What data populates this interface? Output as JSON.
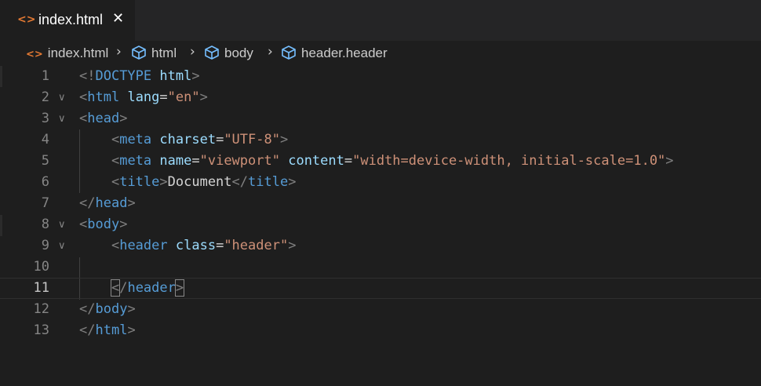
{
  "tab": {
    "icon": "<>",
    "label": "index.html",
    "close": "✕"
  },
  "breadcrumb": [
    {
      "label": "index.html",
      "icon": "html-file-icon"
    },
    {
      "label": "html",
      "icon": "cube-icon"
    },
    {
      "label": "body",
      "icon": "cube-icon"
    },
    {
      "label": "header.header",
      "icon": "cube-icon"
    }
  ],
  "breadcrumb_separator": "›",
  "fold_glyph": "∨",
  "colors": {
    "tag": "#569cd6",
    "attr": "#9cdcfe",
    "string": "#ce9178",
    "punct": "#808080",
    "text": "#d4d4d4",
    "line_number": "#858585",
    "file_icon": "#e37933"
  },
  "lines": [
    {
      "n": "1",
      "tokens": [
        [
          "p",
          "<!"
        ],
        [
          "t",
          "DOCTYPE"
        ],
        [
          "x",
          " "
        ],
        [
          "a",
          "html"
        ],
        [
          "p",
          ">"
        ]
      ]
    },
    {
      "n": "2",
      "fold": true,
      "tokens": [
        [
          "p",
          "<"
        ],
        [
          "t",
          "html"
        ],
        [
          "x",
          " "
        ],
        [
          "a",
          "lang"
        ],
        [
          "x",
          "="
        ],
        [
          "s",
          "\"en\""
        ],
        [
          "p",
          ">"
        ]
      ]
    },
    {
      "n": "3",
      "fold": true,
      "tokens": [
        [
          "p",
          "<"
        ],
        [
          "t",
          "head"
        ],
        [
          "p",
          ">"
        ]
      ]
    },
    {
      "n": "4",
      "tokens": [
        [
          "x",
          "    "
        ],
        [
          "p",
          "<"
        ],
        [
          "t",
          "meta"
        ],
        [
          "x",
          " "
        ],
        [
          "a",
          "charset"
        ],
        [
          "x",
          "="
        ],
        [
          "s",
          "\"UTF-8\""
        ],
        [
          "p",
          ">"
        ]
      ]
    },
    {
      "n": "5",
      "tokens": [
        [
          "x",
          "    "
        ],
        [
          "p",
          "<"
        ],
        [
          "t",
          "meta"
        ],
        [
          "x",
          " "
        ],
        [
          "a",
          "name"
        ],
        [
          "x",
          "="
        ],
        [
          "s",
          "\"viewport\""
        ],
        [
          "x",
          " "
        ],
        [
          "a",
          "content"
        ],
        [
          "x",
          "="
        ],
        [
          "s",
          "\"width=device-width, initial-scale=1.0\""
        ],
        [
          "p",
          ">"
        ]
      ]
    },
    {
      "n": "6",
      "tokens": [
        [
          "x",
          "    "
        ],
        [
          "p",
          "<"
        ],
        [
          "t",
          "title"
        ],
        [
          "p",
          ">"
        ],
        [
          "x",
          "Document"
        ],
        [
          "p",
          "</"
        ],
        [
          "t",
          "title"
        ],
        [
          "p",
          ">"
        ]
      ]
    },
    {
      "n": "7",
      "tokens": [
        [
          "p",
          "</"
        ],
        [
          "t",
          "head"
        ],
        [
          "p",
          ">"
        ]
      ]
    },
    {
      "n": "8",
      "fold": true,
      "tokens": [
        [
          "p",
          "<"
        ],
        [
          "t",
          "body"
        ],
        [
          "p",
          ">"
        ]
      ]
    },
    {
      "n": "9",
      "fold": true,
      "tokens": [
        [
          "x",
          "    "
        ],
        [
          "p",
          "<"
        ],
        [
          "t",
          "header"
        ],
        [
          "x",
          " "
        ],
        [
          "a",
          "class"
        ],
        [
          "x",
          "="
        ],
        [
          "s",
          "\"header\""
        ],
        [
          "p",
          ">"
        ]
      ]
    },
    {
      "n": "10",
      "tokens": []
    },
    {
      "n": "11",
      "current": true,
      "tokens": [
        [
          "x",
          "    "
        ],
        [
          "p",
          "<",
          "box"
        ],
        [
          "p",
          "/"
        ],
        [
          "t",
          "header"
        ],
        [
          "p",
          ">",
          "box"
        ]
      ]
    },
    {
      "n": "12",
      "tokens": [
        [
          "p",
          "</"
        ],
        [
          "t",
          "body"
        ],
        [
          "p",
          ">"
        ]
      ]
    },
    {
      "n": "13",
      "tokens": [
        [
          "p",
          "</"
        ],
        [
          "t",
          "html"
        ],
        [
          "p",
          ">"
        ]
      ]
    }
  ]
}
